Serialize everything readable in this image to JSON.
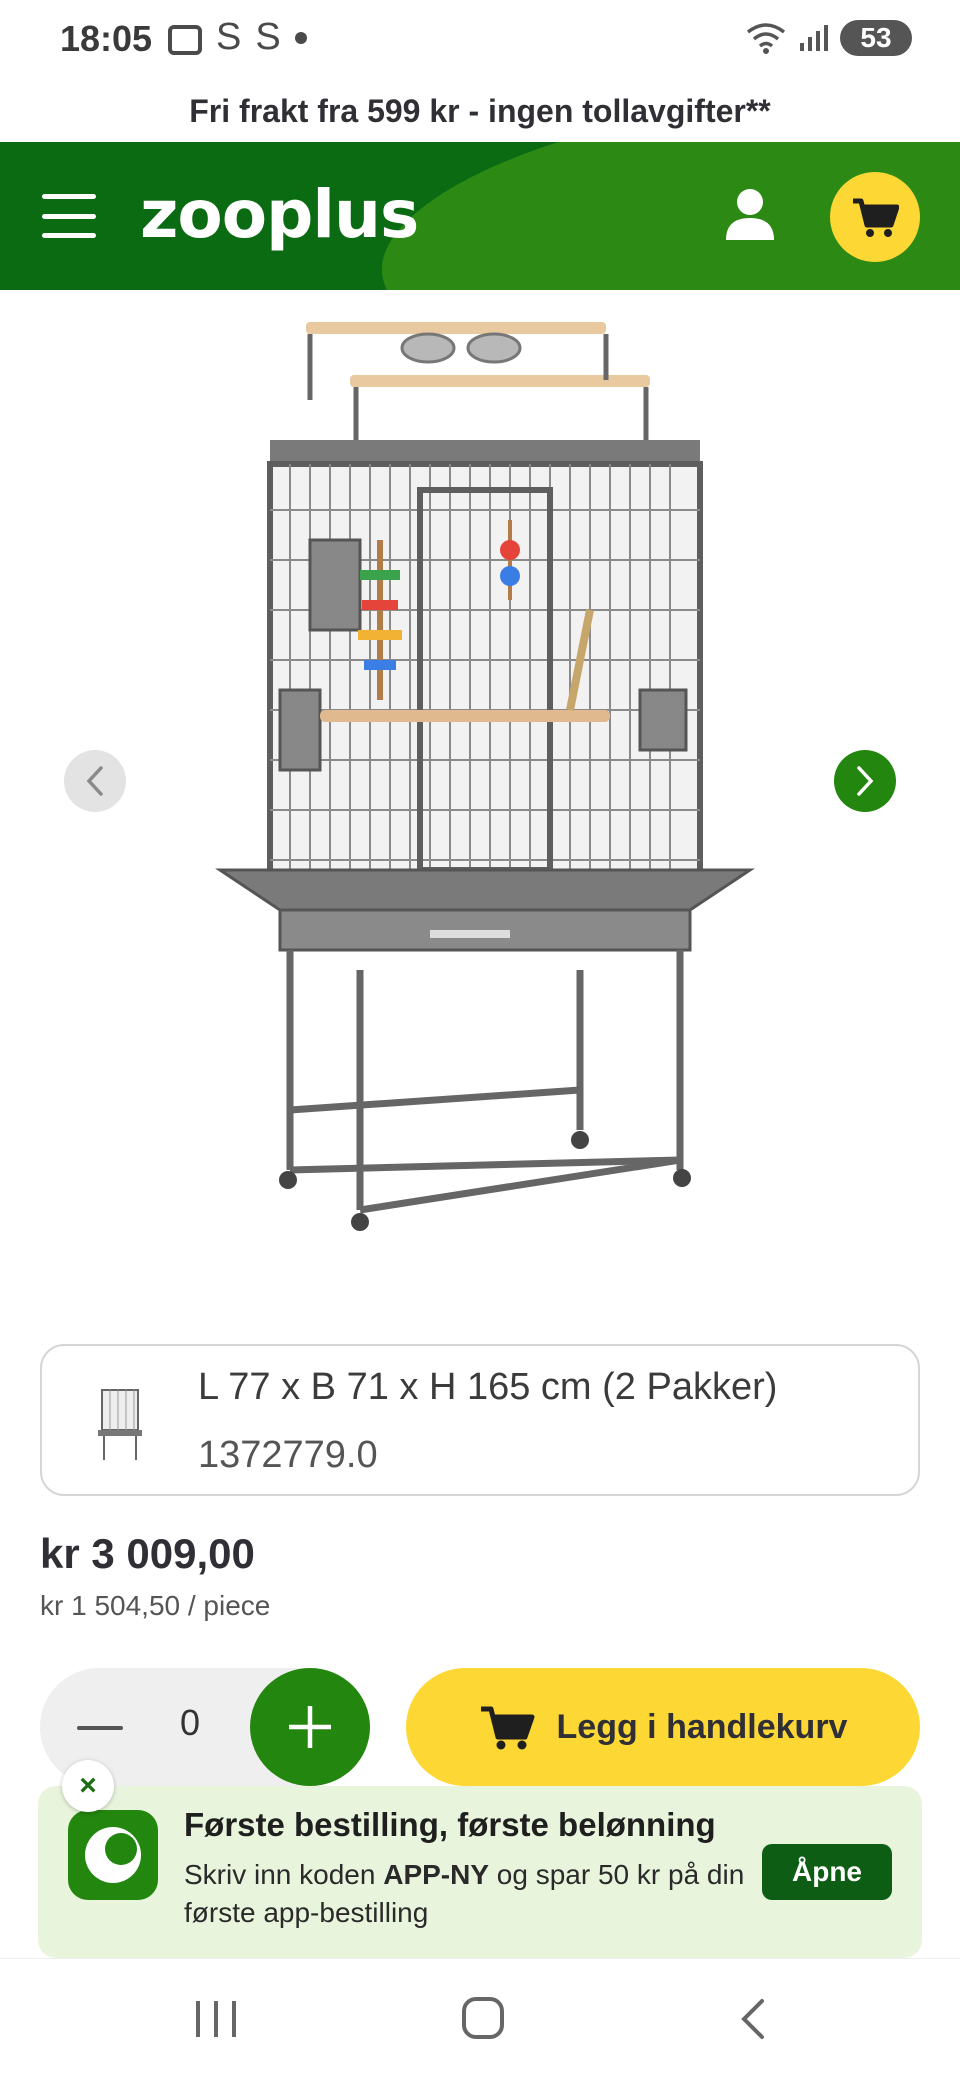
{
  "status_bar": {
    "time": "18:05",
    "left_icons": [
      "screenshot-icon",
      "s-icon",
      "s-icon",
      "dot-icon"
    ],
    "left_letters": [
      "S",
      "S"
    ],
    "battery": "53",
    "right_icons": [
      "wifi-icon",
      "signal-icon",
      "battery-icon"
    ]
  },
  "promo": {
    "text": "Fri frakt fra 599 kr - ingen tollavgifter**"
  },
  "header": {
    "logo": "zooplus",
    "menu_icon": "hamburger-menu-icon",
    "account_icon": "user-icon",
    "cart_icon": "cart-icon",
    "colors": {
      "primary": "#0b6b12",
      "secondary": "#2c8a14",
      "accent": "#fdd835"
    }
  },
  "product": {
    "image": "bird-cage-image",
    "prev_icon": "chevron-left-icon",
    "next_icon": "chevron-right-icon",
    "variant": {
      "name": "L 77 x B 71 x H 165 cm (2 Pakker)",
      "sku": "1372779.0"
    },
    "price": "kr 3 009,00",
    "unit_price": "kr 1 504,50 / piece"
  },
  "purchase": {
    "quantity": "0",
    "minus_icon": "minus-icon",
    "plus_icon": "plus-icon",
    "add_to_cart_label": "Legg i handlekurv"
  },
  "banner": {
    "close": "×",
    "title": "Første bestilling, første belønning",
    "text_before": "Skriv inn koden ",
    "code": "APP-NY",
    "text_after": " og spar 50 kr på din første app-bestilling",
    "open_label": "Åpne"
  },
  "navbar": {
    "icons": [
      "recent-apps-icon",
      "home-icon",
      "back-icon"
    ]
  }
}
